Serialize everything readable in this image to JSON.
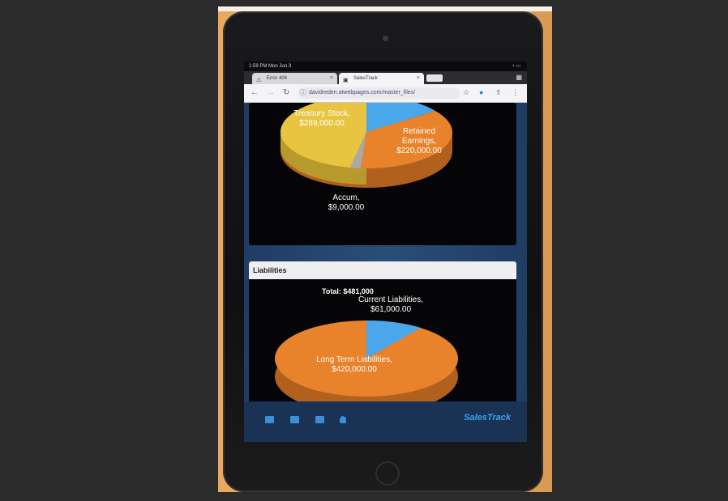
{
  "status": {
    "time": "1:59 PM  Mon Jun 3",
    "icons": "◔ ▭"
  },
  "tabs": [
    {
      "label": "Error 404",
      "icon": "warning-icon"
    },
    {
      "label": "SalesTrack",
      "icon": "page-icon"
    }
  ],
  "address": {
    "url": "davidreden.atwebpages.com/master_files/"
  },
  "equity_chart": {
    "labels": [
      {
        "text": "Treasury Stock,\n$289,000.00"
      },
      {
        "text": "Retained\nEarnings,\n$220,000.00"
      },
      {
        "text": "Accum,\n$9,000.00"
      }
    ]
  },
  "liabilities": {
    "title": "Liabilities",
    "total": "Total: $481,000",
    "labels": [
      {
        "text": "Current Liabilities,\n$61,000.00"
      },
      {
        "text": "Long Term Liabilities,\n$420,000.00"
      }
    ]
  },
  "bottom_nav": {
    "brand": "SalesTrack"
  },
  "colors": {
    "orange": "#e8822b",
    "yellow": "#e8c540",
    "blue": "#4aa8ea",
    "gray": "#9a9a9a",
    "nav": "#1a3355"
  }
}
